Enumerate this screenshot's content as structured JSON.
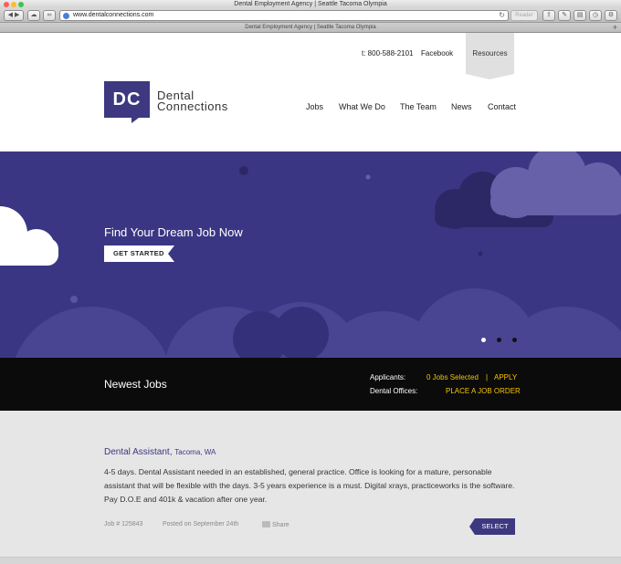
{
  "browser": {
    "window_title": "Dental Employment Agency | Seattle Tacoma Olympia",
    "tab_title": "Dental Employment Agency | Seattle Tacoma Olympia",
    "url": "www.dentalconnections.com",
    "reader_label": "Reader"
  },
  "header": {
    "phone": "t: 800-588-2101",
    "facebook": "Facebook",
    "resources": "Resources",
    "logo_mark": "DC",
    "logo_line1": "Dental",
    "logo_line2": "Connections",
    "nav": [
      "Jobs",
      "What We Do",
      "The Team",
      "News",
      "Contact"
    ]
  },
  "hero": {
    "title": "Find Your Dream Job Now",
    "cta": "GET STARTED",
    "slides": 3,
    "active_slide": 1
  },
  "jobs_bar": {
    "title": "Newest Jobs",
    "applicants_label": "Applicants:",
    "jobs_selected": "0 Jobs Selected",
    "separator": "|",
    "apply": "APPLY",
    "offices_label": "Dental Offices:",
    "place_order": "PLACE A JOB ORDER"
  },
  "job": {
    "title": "Dental Assistant,",
    "location": "Tacoma, WA",
    "description": "4-5 days. Dental Assistant needed in an established, general practice. Office is looking for a mature, personable assistant  that will be flexible with the days.  3-5 years experience is a must.  Digital xrays, practiceworks is the software.  Pay D.O.E and 401k & vacation after one year.",
    "job_number": "Job # 125843",
    "posted": "Posted on September 24th",
    "share": "Share",
    "select": "SELECT"
  },
  "colors": {
    "brand": "#3d3880",
    "hero_bg": "#3b3683",
    "accent_yellow": "#f5c400"
  }
}
